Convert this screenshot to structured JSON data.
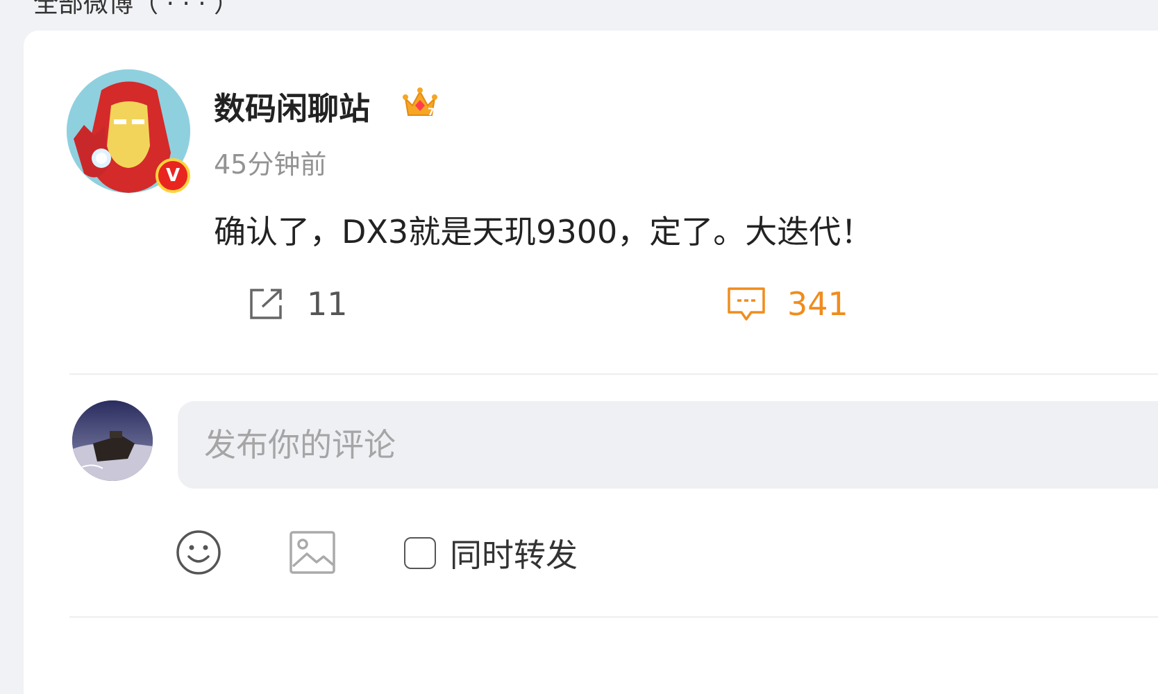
{
  "section": {
    "header_partial": "全部微博（ · · · ）"
  },
  "post": {
    "author": {
      "name": "数码闲聊站",
      "verified_badge": "V",
      "crown_icon": "crown-icon",
      "crown_level": "7"
    },
    "time": "45分钟前",
    "text": "确认了，DX3就是天玑9300，定了。大迭代！",
    "actions": {
      "repost": {
        "icon": "repost-icon",
        "count": "11"
      },
      "comment": {
        "icon": "comment-icon",
        "count": "341",
        "color": "#f08c1d"
      }
    }
  },
  "composer": {
    "placeholder": "发布你的评论",
    "emoji_icon": "emoji-icon",
    "image_icon": "image-icon",
    "repost_toggle_label": "同时转发",
    "repost_toggle_checked": false
  },
  "colors": {
    "accent": "#f08c1d",
    "background": "#f1f2f5",
    "card": "#ffffff",
    "input_bg": "#eff0f4"
  }
}
